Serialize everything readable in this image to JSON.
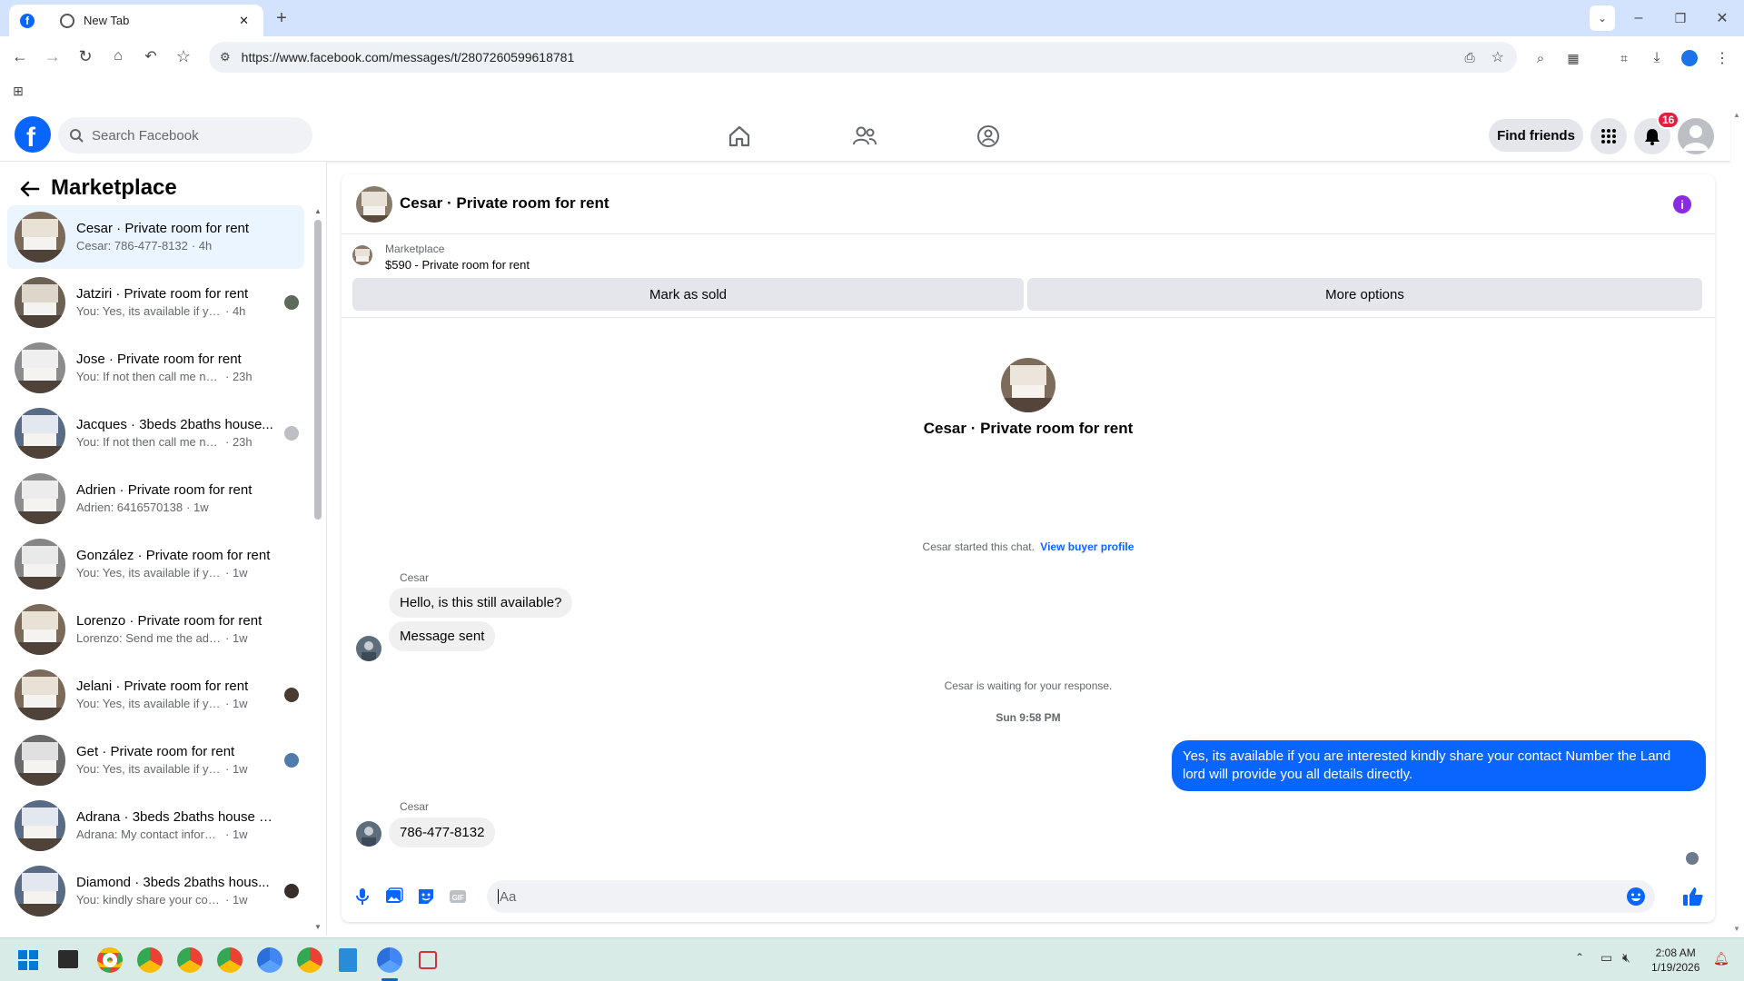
{
  "browser": {
    "active_tab_title": "",
    "second_tab_title": "New Tab",
    "url": "https://www.facebook.com/messages/t/2807260599618781"
  },
  "fb": {
    "search_placeholder": "Search Facebook",
    "find_friends": "Find friends",
    "notification_count": "16"
  },
  "sidebar": {
    "title": "Marketplace",
    "conversations": [
      {
        "name": "Cesar · Private room for rent",
        "snippet": "Cesar: 786-477-8132",
        "time": "· 4h",
        "active": true
      },
      {
        "name": "Jatziri · Private room for rent",
        "snippet": "You: Yes, its available if you are i...",
        "time": "· 4h",
        "active": false
      },
      {
        "name": "Jose · Private room for rent",
        "snippet": "You: If not then call me now bcz i'...",
        "time": "· 23h",
        "active": false
      },
      {
        "name": "Jacques · 3beds 2baths house...",
        "snippet": "You: If not then call me now bc...",
        "time": "· 23h",
        "active": false
      },
      {
        "name": "Adrien · Private room for rent",
        "snippet": "Adrien: 6416570138",
        "time": "· 1w",
        "active": false
      },
      {
        "name": "González · Private room for rent",
        "snippet": "You: Yes, its available if you are int...",
        "time": "· 1w",
        "active": false
      },
      {
        "name": "Lorenzo · Private room for rent",
        "snippet": "Lorenzo: Send me the address",
        "time": "· 1w",
        "active": false
      },
      {
        "name": "Jelani · Private room for rent",
        "snippet": "You: Yes, its available if you are i...",
        "time": "· 1w",
        "active": false
      },
      {
        "name": "Get · Private room for rent",
        "snippet": "You: Yes, its available if you are i...",
        "time": "· 1w",
        "active": false
      },
      {
        "name": "Adrana · 3beds 2baths house fo...",
        "snippet": "Adrana: My contact information is ...",
        "time": "· 1w",
        "active": false
      },
      {
        "name": "Diamond · 3beds 2baths hous...",
        "snippet": "You: kindly share your contact ...",
        "time": "· 1w",
        "active": false
      }
    ]
  },
  "chat": {
    "title": "Cesar · Private room for rent",
    "marketplace_label": "Marketplace",
    "listing": "$590 - Private room for rent",
    "mark_sold": "Mark as sold",
    "more_options": "More options",
    "center_title": "Cesar · Private room for rent",
    "started_text": "Cesar started this chat.",
    "view_buyer_profile": "View buyer profile",
    "sender1": "Cesar",
    "msg1": "Hello, is this still available?",
    "msg2": "Message sent",
    "waiting": "Cesar is waiting for your response.",
    "timestamp": "Sun 9:58 PM",
    "my_msg": "Yes, its available if you are interested kindly share your contact Number the Land lord will provide you all details directly.",
    "sender2": "Cesar",
    "msg3": "786-477-8132",
    "input_placeholder": "Aa"
  },
  "taskbar": {
    "time": "2:08 AM",
    "date": "1/19/2026"
  },
  "colors": {
    "fb_blue": "#0866ff",
    "active_conv": "#ebf5ff",
    "notif_red": "#e41e3f"
  }
}
